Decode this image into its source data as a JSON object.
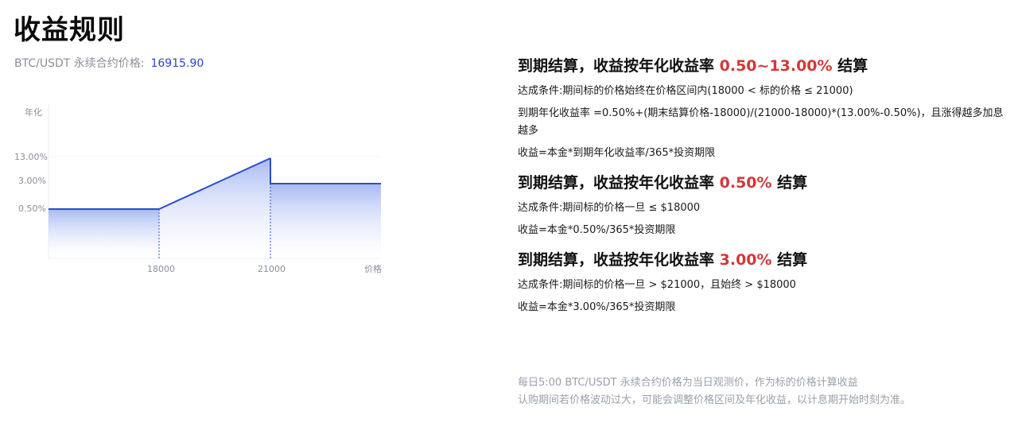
{
  "page": {
    "title": "收益规则",
    "price_label": "BTC/USDT 永续合约价格:",
    "price_value": "16915.90"
  },
  "chart_data": {
    "type": "area",
    "ylabel": "年化",
    "xlabel": "价格",
    "y_tick_labels": [
      "13.00%",
      "3.00%",
      "0.50%"
    ],
    "x_tick_labels": [
      "18000",
      "21000"
    ],
    "series": [
      {
        "points": [
          {
            "x": "<18000",
            "y": 0.5
          },
          {
            "x": 18000,
            "y": 0.5
          },
          {
            "x": 21000,
            "y": 13.0
          },
          {
            "x": ">21000",
            "y": 3.0
          }
        ]
      }
    ],
    "colors": {
      "line": "#2a4bd0",
      "fill_top": "#9eb1f2",
      "fill_bottom": "#ffffff"
    }
  },
  "rules": [
    {
      "heading_prefix": "到期结算，收益按年化收益率 ",
      "rate": "0.50~13.00%",
      "heading_suffix": " 结算",
      "lines": [
        "达成条件:期间标的价格始终在价格区间内(18000 < 标的价格 ≤ 21000)",
        "到期年化收益率 =0.50%+(期末结算价格-18000)/(21000-18000)*(13.00%-0.50%)，且涨得越多加息越多",
        "收益=本金*到期年化收益率/365*投资期限"
      ]
    },
    {
      "heading_prefix": "到期结算，收益按年化收益率 ",
      "rate": "0.50%",
      "heading_suffix": " 结算",
      "lines": [
        "达成条件:期间标的价格一旦 ≤ $18000",
        "收益=本金*0.50%/365*投资期限"
      ]
    },
    {
      "heading_prefix": "到期结算，收益按年化收益率 ",
      "rate": "3.00%",
      "heading_suffix": " 结算",
      "lines": [
        "达成条件:期间标的价格一旦 > $21000，且始终 > $18000",
        "收益=本金*3.00%/365*投资期限"
      ]
    }
  ],
  "notes": [
    "每日5:00 BTC/USDT 永续合约价格为当日观测价，作为标的价格计算收益",
    "认购期间若价格波动过大，可能会调整价格区间及年化收益，以计息期开始时刻为准。"
  ]
}
